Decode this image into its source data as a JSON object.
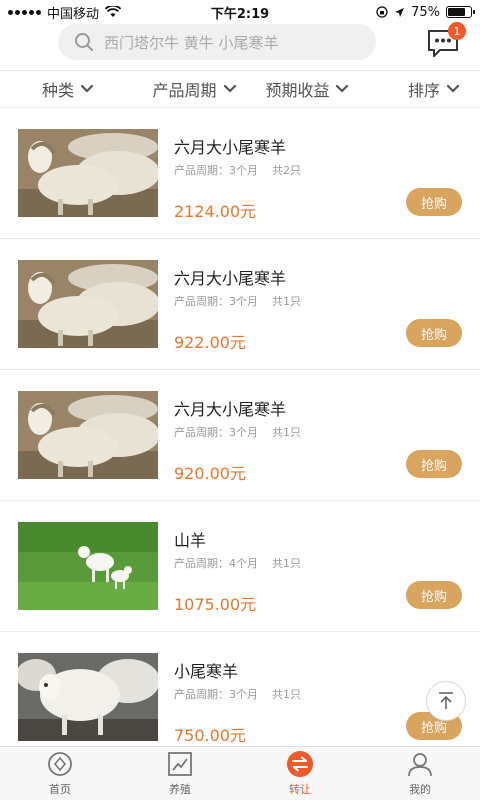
{
  "status": {
    "carrier": "中国移动",
    "time": "下午2:19",
    "battery": "75%",
    "battery_level": 0.75
  },
  "search": {
    "placeholder": "西门塔尔牛 黄牛 小尾寒羊"
  },
  "messages": {
    "badge_count": "1"
  },
  "filters": [
    {
      "label": "种类"
    },
    {
      "label": "产品周期"
    },
    {
      "label": "预期收益"
    },
    {
      "label": "排序"
    }
  ],
  "products": [
    {
      "title": "六月大小尾寒羊",
      "period": "产品周期：3个月",
      "count": "共2只",
      "price": "2124.00元",
      "button": "抢购",
      "image": "sheep-flock"
    },
    {
      "title": "六月大小尾寒羊",
      "period": "产品周期：3个月",
      "count": "共1只",
      "price": "922.00元",
      "button": "抢购",
      "image": "sheep-flock"
    },
    {
      "title": "六月大小尾寒羊",
      "period": "产品周期：3个月",
      "count": "共1只",
      "price": "920.00元",
      "button": "抢购",
      "image": "sheep-flock"
    },
    {
      "title": "山羊",
      "period": "产品周期：4个月",
      "count": "共1只",
      "price": "1075.00元",
      "button": "抢购",
      "image": "goats-on-grass"
    },
    {
      "title": "小尾寒羊",
      "period": "产品周期：3个月",
      "count": "共1只",
      "price": "750.00元",
      "button": "抢购",
      "image": "sheep-pen"
    }
  ],
  "tabs": [
    {
      "label": "首页",
      "icon": "home-icon",
      "active": false
    },
    {
      "label": "养殖",
      "icon": "chart-icon",
      "active": false
    },
    {
      "label": "转让",
      "icon": "transfer-icon",
      "active": true
    },
    {
      "label": "我的",
      "icon": "user-icon",
      "active": false
    }
  ],
  "colors": {
    "accent": "#f05a2a",
    "price": "#e8762c",
    "buy_button": "#d9a55e"
  }
}
